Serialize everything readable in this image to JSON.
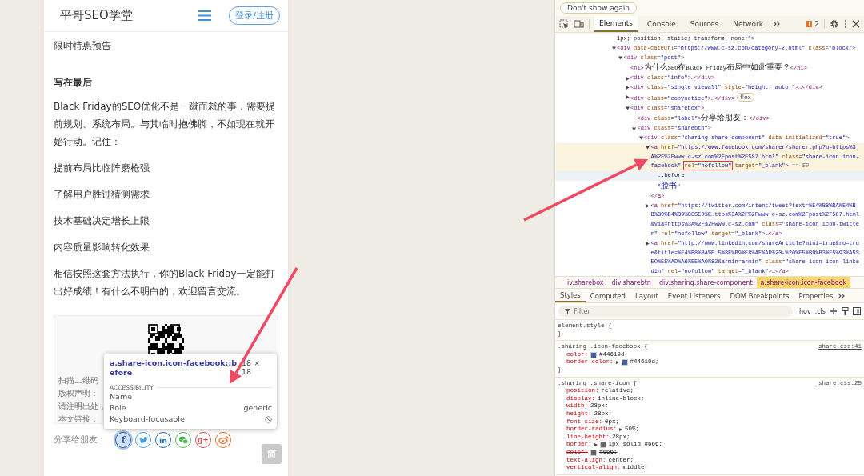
{
  "article_page": {
    "site_title": "平哥SEO学堂",
    "login_button": "登录/注册",
    "blocks": [
      {
        "kind": "paragraph",
        "text": "限时特惠预告"
      },
      {
        "kind": "heading",
        "text": "写在最后"
      },
      {
        "kind": "paragraph",
        "text": "Black Friday的SEO优化不是一蹴而就的事，需要提前规划、系统布局。与其临时抱佛脚，不如现在就开始行动。记住："
      },
      {
        "kind": "paragraph",
        "text": "提前布局比临阵磨枪强"
      },
      {
        "kind": "paragraph",
        "text": "了解用户胜过猜测需求"
      },
      {
        "kind": "paragraph",
        "text": "技术基础决定增长上限"
      },
      {
        "kind": "paragraph",
        "text": "内容质量影响转化效果"
      },
      {
        "kind": "paragraph",
        "text": "相信按照这套方法执行，你的Black Friday一定能打出好成绩！有什么不明白的，欢迎留言交流。"
      }
    ],
    "copy_notice": {
      "lines": [
        "扫描二维码",
        "版权声明：",
        "请注明出处，",
        "本文链接："
      ]
    },
    "share": {
      "label": "分享给朋友：",
      "icons": [
        {
          "kind": "facebook",
          "glyph": "f",
          "color": "#44619d",
          "selected": true
        },
        {
          "kind": "twitter",
          "color": "#3fa3e3",
          "selected": false
        },
        {
          "kind": "linkedin",
          "glyph": "in",
          "color": "#1b6fb0",
          "selected": false
        },
        {
          "kind": "wechat",
          "color": "#5cb85c",
          "selected": false
        },
        {
          "kind": "googleplus",
          "glyph": "g+",
          "color": "#d9534f",
          "selected": false
        },
        {
          "kind": "weibo",
          "color": "#e8712f",
          "selected": false
        }
      ]
    },
    "language_button": "简",
    "inspect_tooltip": {
      "selector": "a.share-icon.icon-facebook::before",
      "size": "18 × 18",
      "section": "ACCESSIBILITY",
      "rows": [
        {
          "label": "Name"
        },
        {
          "label": "Role",
          "value": "generic"
        },
        {
          "label": "Keyboard-focusable",
          "focusable": false
        }
      ]
    }
  },
  "devtools": {
    "notice_button": "Don't show again",
    "tabs": [
      {
        "label": "Elements",
        "selected": true
      },
      {
        "label": "Console",
        "selected": false
      },
      {
        "label": "Sources",
        "selected": false
      },
      {
        "label": "Network",
        "selected": false
      }
    ],
    "issues_count": "2",
    "dom_tree": [
      {
        "text": "1px; position: static; transform: none;\">"
      },
      {
        "text": "<div data-cateurl=\"https://www.c-sz.com/category-2.html\" class=\"block\">",
        "expanded": true,
        "children": [
          {
            "text": "<div class=\"post\">",
            "expanded": true,
            "children": [
              {
                "text": "<h1>为什么SEO在Black Friday布局中如此重要？</h1>"
              },
              {
                "text": "<div class=\"info\">…</div>",
                "expanded": false
              },
              {
                "text": "<div class=\"single viewall\" style=\"height: auto;\">…</div>",
                "expanded": false
              },
              {
                "text": "<div class=\"copynotice\">…</div>",
                "expanded": false,
                "badge": "flex"
              },
              {
                "text": "<div class=\"sharebox\">",
                "expanded": true,
                "children": [
                  {
                    "text": "<div class=\"label\">分享给朋友：</div>"
                  },
                  {
                    "text": "<div class=\"sharebtn\">",
                    "expanded": true,
                    "children": [
                      {
                        "text": "<div class=\"sharing share-component\" data-initialized=\"true\">",
                        "expanded": true,
                        "children": [
                          {
                            "parts": [
                              {
                                "text": "<a href=\"https://www.facebook.com/sharer/sharer.php?u=https%3A%2F%2Fwww.c-sz.com%2Fpost%2F587.html\" class=\"share-icon icon-facebook\" ",
                                "boxed": false
                              },
                              {
                                "text": "rel=\"nofollow\"",
                                "boxed": true
                              },
                              {
                                "text": " target=\"_blank\"> ",
                                "boxed": false
                              },
                              {
                                "text": "== $0",
                                "boxed": false,
                                "kind": "ref"
                              }
                            ],
                            "expanded": true,
                            "selected": true,
                            "children": [
                              {
                                "text": "::before",
                                "hovered": true
                              },
                              {
                                "text": "\"脸书\""
                              }
                            ]
                          },
                          {
                            "text": "</a>"
                          },
                          {
                            "text": "<a href=\"https://twitter.com/intent/tweet?text=%E4%B8%BA%E4%BB%80%E4%B9%88SEO%E…ttps%3A%2F%2Fwww.c-sz.com%2Fpost%2F587.html&via=https%3A%2F%2Fwww.c-sz.com\" class=\"share-icon icon-twitter\" rel=\"nofollow\" target=\"_blank\">…</a>",
                            "expanded": false
                          },
                          {
                            "text": "<a href=\"http://www.linkedin.com/shareArticle?mini=true&ro=true&title=%E4%B8%BA%E…5%8F%B9%E8%AE%AD%20-%20%E5%B9%B3%E5%93%A5SEO%E5%AD%A6%E5%A0%82&armin=armin\" class=\"share-icon icon-linkedin\" rel=\"nofollow\" target=\"_blank\">…</a>",
                            "expanded": false
                          }
                        ]
                      }
                    ]
                  }
                ]
              }
            ]
          }
        ]
      }
    ],
    "breadcrumbs": [
      {
        "label": "iv.sharebox",
        "selected": false
      },
      {
        "label": "div.sharebtn",
        "selected": false
      },
      {
        "label": "div.sharing.share-component",
        "selected": false
      },
      {
        "label": "a.share-icon.icon-facebook",
        "selected": true
      }
    ],
    "styles_tabs": [
      {
        "label": "Styles",
        "selected": true
      },
      {
        "label": "Computed",
        "selected": false
      },
      {
        "label": "Layout",
        "selected": false
      },
      {
        "label": "Event Listeners",
        "selected": false
      },
      {
        "label": "DOM Breakpoints",
        "selected": false
      },
      {
        "label": "Properties",
        "selected": false
      }
    ],
    "filter": {
      "placeholder": "Filter"
    },
    "filter_buttons": [
      ":hov",
      ".cls"
    ],
    "rules": [
      {
        "selector": "element.style {",
        "close": "}"
      },
      {
        "selector": ".sharing .icon-facebook {",
        "source": "share.css:41",
        "close": "}",
        "declarations": [
          {
            "property": "color:",
            "value": "#44619d;",
            "color": "#44619d"
          },
          {
            "property": "border-color:",
            "value": "#44619d;",
            "color": "#44619d",
            "expandable": true
          }
        ]
      },
      {
        "selector": ".sharing .share-icon {",
        "source": "share.css:25",
        "declarations": [
          {
            "property": "position:",
            "value": "relative;"
          },
          {
            "property": "display:",
            "value": "inline-block;"
          },
          {
            "property": "width:",
            "value": "28px;"
          },
          {
            "property": "height:",
            "value": "28px;"
          },
          {
            "property": "font-size:",
            "value": "0px;"
          },
          {
            "property": "border-radius:",
            "value": "50%;",
            "expandable": true
          },
          {
            "property": "line-height:",
            "value": "28px;"
          },
          {
            "property": "border:",
            "value": "1px solid #666;",
            "color": "#666666",
            "expandable": true
          },
          {
            "property": "color:",
            "value": "#666;",
            "color": "#666666",
            "overridden": true
          },
          {
            "property": "text-align:",
            "value": "center;"
          },
          {
            "property": "vertical-align:",
            "value": "middle;"
          }
        ]
      }
    ]
  }
}
